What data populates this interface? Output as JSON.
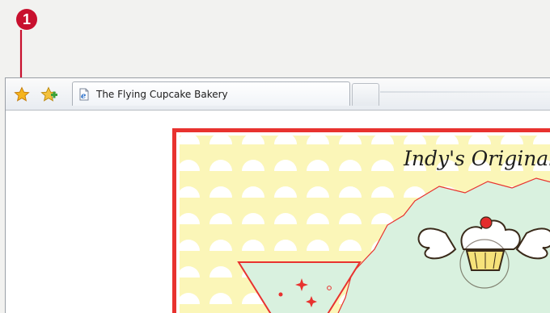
{
  "callout": {
    "number": "1"
  },
  "browser": {
    "favorites_button_icon": "star-icon",
    "add_favorites_button_icon": "add-star-icon",
    "tab": {
      "favicon": "ie-page-icon",
      "title": "The Flying Cupcake Bakery"
    },
    "new_tab_button_icon": "new-tab-icon"
  },
  "page": {
    "headline": "Indy's Original",
    "colors": {
      "border": "#e8322f",
      "background": "#fbf6b8",
      "scallop": "#ffffff",
      "mint": "#d9f1df",
      "cherry": "#e42c2c"
    }
  }
}
